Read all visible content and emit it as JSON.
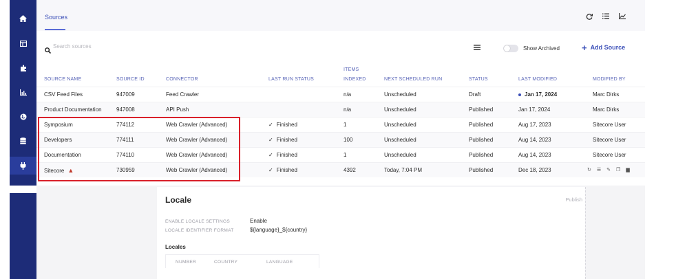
{
  "nav": {
    "icons": [
      "home-icon",
      "layout-icon",
      "puzzle-icon",
      "chart-icon",
      "globe-icon",
      "database-icon",
      "plug-icon"
    ]
  },
  "tabs": {
    "sources": "Sources"
  },
  "toolbar": {
    "search_placeholder": "Search sources",
    "show_archived": "Show Archived",
    "add_source": "Add Source"
  },
  "table": {
    "headers": {
      "source_name": "SOURCE NAME",
      "source_id": "SOURCE ID",
      "connector": "CONNECTOR",
      "last_run_status": "LAST RUN STATUS",
      "items_indexed_1": "ITEMS",
      "items_indexed_2": "INDEXED",
      "next_run": "NEXT SCHEDULED RUN",
      "status": "STATUS",
      "last_modified": "LAST MODIFIED",
      "modified_by": "MODIFIED BY"
    },
    "rows": [
      {
        "name": "CSV Feed Files",
        "id": "947009",
        "connector": "Feed Crawler",
        "last_run": "",
        "indexed": "n/a",
        "next_run": "Unscheduled",
        "status": "Draft",
        "modified": "Jan 17, 2024",
        "by": "Marc Dirks"
      },
      {
        "name": "Product Documentation",
        "id": "947008",
        "connector": "API Push",
        "last_run": "",
        "indexed": "n/a",
        "next_run": "Unscheduled",
        "status": "Published",
        "modified": "Jan 17, 2024",
        "by": "Marc Dirks"
      },
      {
        "name": "Symposium",
        "id": "774112",
        "connector": "Web Crawler (Advanced)",
        "last_run": "Finished",
        "indexed": "1",
        "next_run": "Unscheduled",
        "status": "Published",
        "modified": "Aug 17, 2023",
        "by": "Sitecore User"
      },
      {
        "name": "Developers",
        "id": "774111",
        "connector": "Web Crawler (Advanced)",
        "last_run": "Finished",
        "indexed": "100",
        "next_run": "Unscheduled",
        "status": "Published",
        "modified": "Aug 14, 2023",
        "by": "Sitecore User"
      },
      {
        "name": "Documentation",
        "id": "774110",
        "connector": "Web Crawler (Advanced)",
        "last_run": "Finished",
        "indexed": "1",
        "next_run": "Unscheduled",
        "status": "Published",
        "modified": "Aug 14, 2023",
        "by": "Sitecore User"
      },
      {
        "name": "Sitecore",
        "id": "730959",
        "connector": "Web Crawler (Advanced)",
        "last_run": "Finished",
        "indexed": "4392",
        "next_run": "Today, 7:04 PM",
        "status": "Published",
        "modified": "Dec 18, 2023",
        "by": ""
      }
    ]
  },
  "locale": {
    "title": "Locale",
    "publish": "Publish",
    "enable_key": "ENABLE LOCALE SETTINGS",
    "enable_val": "Enable",
    "format_key": "LOCALE IDENTIFIER FORMAT",
    "format_val": "${language}_${country}",
    "locales_heading": "Locales",
    "columns": [
      "NUMBER",
      "COUNTRY",
      "LANGUAGE"
    ]
  },
  "colors": {
    "nav": "#1d2c78",
    "accent": "#3b4fb8",
    "highlight": "#d9202a"
  }
}
